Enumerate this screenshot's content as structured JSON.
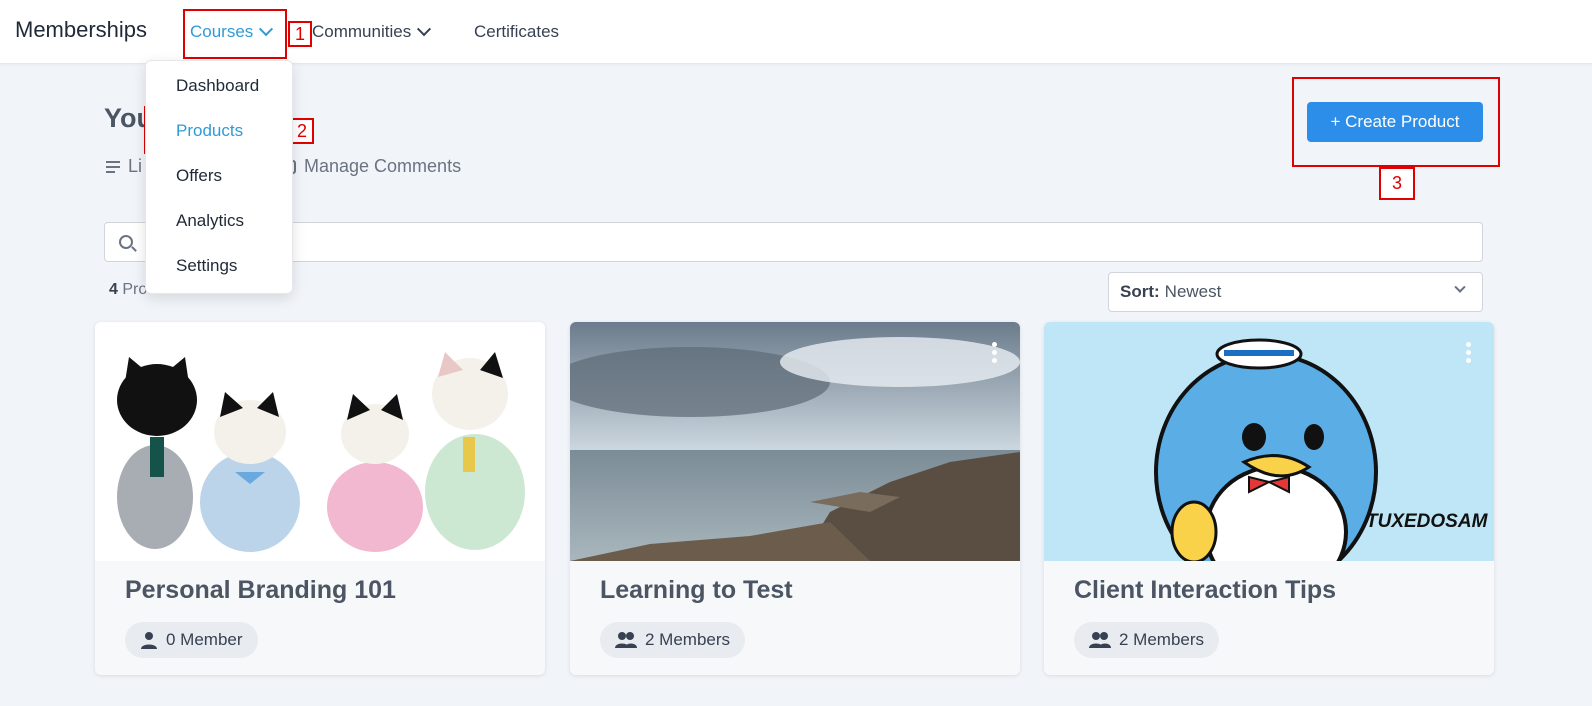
{
  "nav": {
    "brand": "Memberships",
    "items": [
      {
        "label": "Courses"
      },
      {
        "label": "Communities"
      },
      {
        "label": "Certificates"
      }
    ]
  },
  "dropdown": {
    "items": [
      {
        "label": "Dashboard"
      },
      {
        "label": "Products"
      },
      {
        "label": "Offers"
      },
      {
        "label": "Analytics"
      },
      {
        "label": "Settings"
      }
    ]
  },
  "page": {
    "title": "You",
    "subnav_left": "Li",
    "subnav_right": "Manage Comments",
    "create_button": "+ Create Product"
  },
  "search": {
    "placeholder": "",
    "value": ""
  },
  "list": {
    "count": "4",
    "count_label": "Products",
    "sort_label": "Sort:",
    "sort_value": "Newest"
  },
  "cards": [
    {
      "title": "Personal Branding 101",
      "members": "0 Member",
      "image": "calico-critters-cats"
    },
    {
      "title": "Learning to Test",
      "members": "2 Members",
      "image": "rocky-beach-seascape"
    },
    {
      "title": "Client Interaction Tips",
      "members": "2 Members",
      "image": "tuxedosam-penguin",
      "image_text": "TUXEDOSAM"
    }
  ],
  "annotations": [
    "1",
    "2",
    "3"
  ],
  "colors": {
    "accent": "#2f9bd6",
    "button": "#2d8eea",
    "annotation": "#e00000"
  }
}
